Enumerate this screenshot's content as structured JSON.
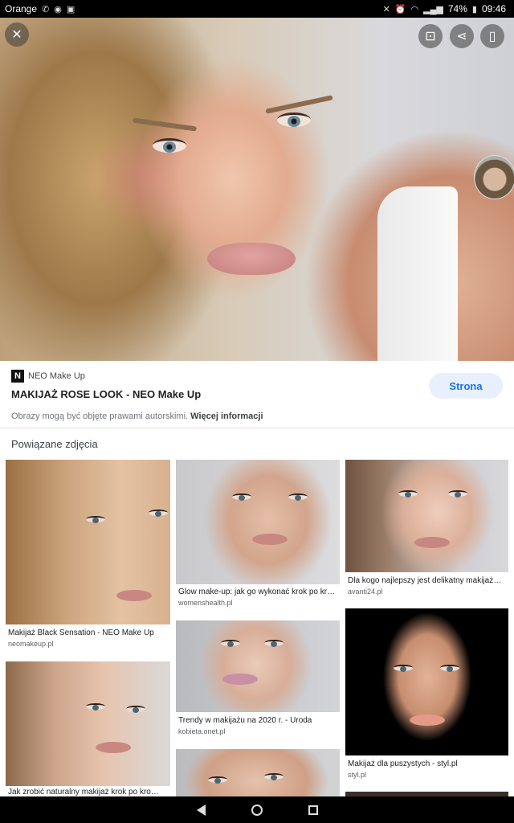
{
  "status_bar": {
    "carrier": "Orange",
    "battery": "74%",
    "time": "09:46"
  },
  "hero": {
    "close_icon": "close-icon",
    "lens_icon": "lens-icon",
    "share_icon": "share-icon",
    "save_icon": "bookmark-icon"
  },
  "source": {
    "logo_letter": "N",
    "site_name": "NEO Make Up",
    "title": "MAKIJAŻ ROSE LOOK - NEO Make Up",
    "visit_label": "Strona",
    "copyright_text": "Obrazy mogą być objęte prawami autorskimi.",
    "copyright_link": "Więcej informacji"
  },
  "related": {
    "heading": "Powiązane zdjęcia",
    "items": [
      {
        "caption": "Makijaż Black Sensation - NEO Make Up",
        "source": "neomakeup.pl"
      },
      {
        "caption": "Glow make-up: jak go wykonać krok po krok…",
        "source": "womenshealth.pl"
      },
      {
        "caption": "Dla kogo najlepszy jest delikatny makijaż…",
        "source": "avanti24.pl"
      },
      {
        "caption": "Trendy w makijażu na 2020 r. - Uroda",
        "source": "kobieta.onet.pl"
      },
      {
        "caption": "Makijaż dla puszystych - styl.pl",
        "source": "styl.pl"
      },
      {
        "caption": "Jak zrobić naturalny makijaż krok po kro…",
        "source": ""
      }
    ]
  },
  "colors": {
    "accent": "#1a73e8",
    "button_bg": "#e8f0fe"
  }
}
